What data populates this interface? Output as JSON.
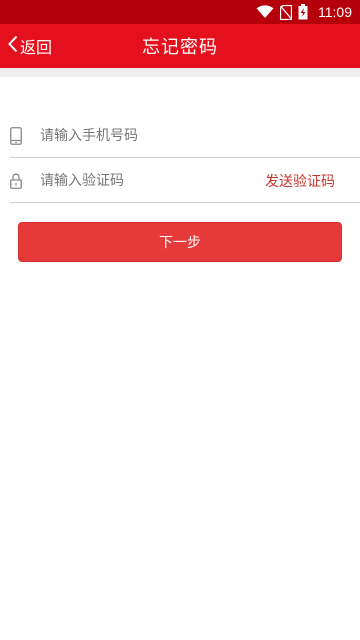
{
  "status_bar": {
    "time": "11:09",
    "icons": [
      "wifi-icon",
      "no-sim-icon",
      "battery-charging-icon"
    ],
    "background": "#b5000c"
  },
  "app_bar": {
    "back_label": "返回",
    "title": "忘记密码",
    "background": "#e5101d"
  },
  "form": {
    "phone": {
      "placeholder": "请输入手机号码",
      "value": "",
      "icon": "phone-icon"
    },
    "code": {
      "placeholder": "请输入验证码",
      "value": "",
      "icon": "lock-icon",
      "send_label": "发送验证码"
    }
  },
  "next_button": {
    "label": "下一步",
    "color": "#e63a3a"
  },
  "colors": {
    "accent": "#e5101d",
    "link": "#c8372d"
  }
}
